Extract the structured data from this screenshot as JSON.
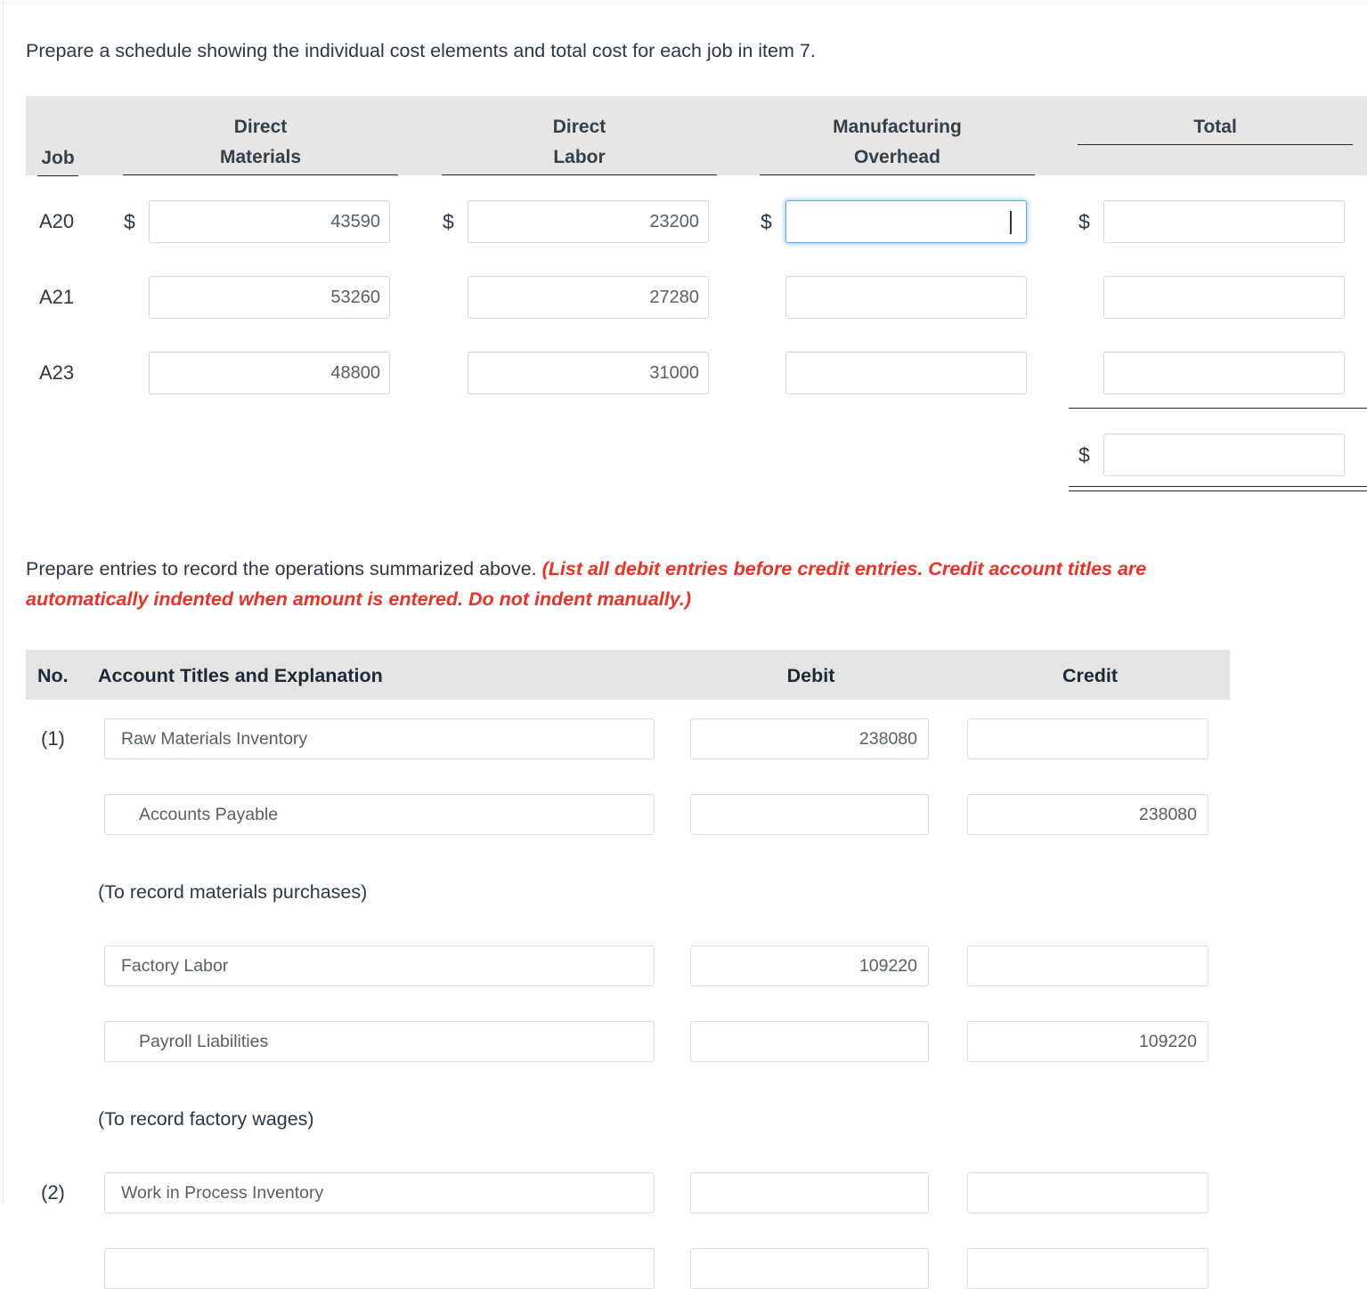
{
  "prompts": {
    "schedule": "Prepare a schedule showing the individual cost elements and total cost for each job in item 7.",
    "entries_plain": "Prepare entries to record the operations summarized above. ",
    "entries_red": "(List all debit entries before credit entries. Credit account titles are automatically indented when amount is entered. Do not indent manually.)"
  },
  "schedule": {
    "headers": {
      "job": "Job",
      "direct_materials_line1": "Direct",
      "direct_materials_line2": "Materials",
      "direct_labor_line1": "Direct",
      "direct_labor_line2": "Labor",
      "overhead_line1": "Manufacturing",
      "overhead_line2": "Overhead",
      "total": "Total"
    },
    "currency_symbol": "$",
    "rows": [
      {
        "job": "A20",
        "direct_materials": "43590",
        "direct_labor": "23200",
        "overhead": "",
        "total": "",
        "overhead_focused": true,
        "show_dollar": true
      },
      {
        "job": "A21",
        "direct_materials": "53260",
        "direct_labor": "27280",
        "overhead": "",
        "total": "",
        "overhead_focused": false,
        "show_dollar": false
      },
      {
        "job": "A23",
        "direct_materials": "48800",
        "direct_labor": "31000",
        "overhead": "",
        "total": "",
        "overhead_focused": false,
        "show_dollar": false
      }
    ],
    "grand_total": {
      "currency_symbol": "$",
      "value": ""
    }
  },
  "journal": {
    "headers": {
      "no": "No.",
      "account": "Account Titles and Explanation",
      "debit": "Debit",
      "credit": "Credit"
    },
    "rows": [
      {
        "kind": "entry",
        "no": "(1)",
        "account": "Raw Materials Inventory",
        "indented": false,
        "debit": "238080",
        "credit": ""
      },
      {
        "kind": "entry",
        "no": "",
        "account": "Accounts Payable",
        "indented": true,
        "debit": "",
        "credit": "238080"
      },
      {
        "kind": "note",
        "note": "(To record materials purchases)"
      },
      {
        "kind": "entry",
        "no": "",
        "account": "Factory Labor",
        "indented": false,
        "debit": "109220",
        "credit": ""
      },
      {
        "kind": "entry",
        "no": "",
        "account": "Payroll Liabilities",
        "indented": true,
        "debit": "",
        "credit": "109220"
      },
      {
        "kind": "note",
        "note": "(To record factory wages)"
      },
      {
        "kind": "entry",
        "no": "(2)",
        "account": "Work in Process Inventory",
        "indented": false,
        "debit": "",
        "credit": ""
      },
      {
        "kind": "entry",
        "no": "",
        "account": "",
        "indented": true,
        "debit": "",
        "credit": ""
      }
    ]
  },
  "colors": {
    "header_band": "#e6e6e6",
    "text": "#2b3844",
    "red_instruction": "#ee3124",
    "focus_border": "#64a7e8",
    "input_border": "#d6d6d6"
  }
}
